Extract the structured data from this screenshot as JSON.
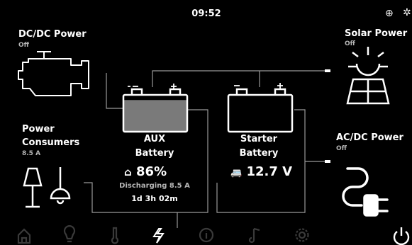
{
  "status_bar": {
    "time": "09:52",
    "globe_icon": "globe-icon",
    "bluetooth_icon": "bluetooth-icon"
  },
  "dcdc": {
    "title": "DC/DC Power",
    "status": "Off",
    "icon": "engine-icon"
  },
  "solar": {
    "title": "Solar Power",
    "status": "Off",
    "icon": "sun-panel-icon"
  },
  "consumers": {
    "title_line1": "Power",
    "title_line2": "Consumers",
    "value": "8.5 A",
    "icon": "lamps-icon"
  },
  "acdc": {
    "title": "AC/DC Power",
    "status": "Off",
    "icon": "plug-icon"
  },
  "aux": {
    "name_line1": "AUX",
    "name_line2": "Battery",
    "soc_text": "86%",
    "soc_fraction": 0.86,
    "state": "Discharging 8.5 A",
    "remaining": "1d 3h 02m",
    "icon": "home-icon",
    "fill_color": "#7a7a7a"
  },
  "starter": {
    "name_line1": "Starter",
    "name_line2": "Battery",
    "voltage": "12.7 V",
    "icon": "van-icon"
  },
  "nav": [
    {
      "name": "home",
      "icon": "home-icon"
    },
    {
      "name": "lights",
      "icon": "bulb-icon"
    },
    {
      "name": "climate",
      "icon": "thermometer-icon"
    },
    {
      "name": "power",
      "icon": "lightning-icon",
      "active": true
    },
    {
      "name": "info",
      "icon": "info-icon"
    },
    {
      "name": "music",
      "icon": "music-icon"
    },
    {
      "name": "settings",
      "icon": "gear-icon"
    },
    {
      "name": "shutdown",
      "icon": "power-icon"
    }
  ],
  "colors": {
    "background": "#000000",
    "foreground": "#ffffff",
    "muted": "#b5b5b5",
    "nav_inactive": "#3a3a3a"
  }
}
